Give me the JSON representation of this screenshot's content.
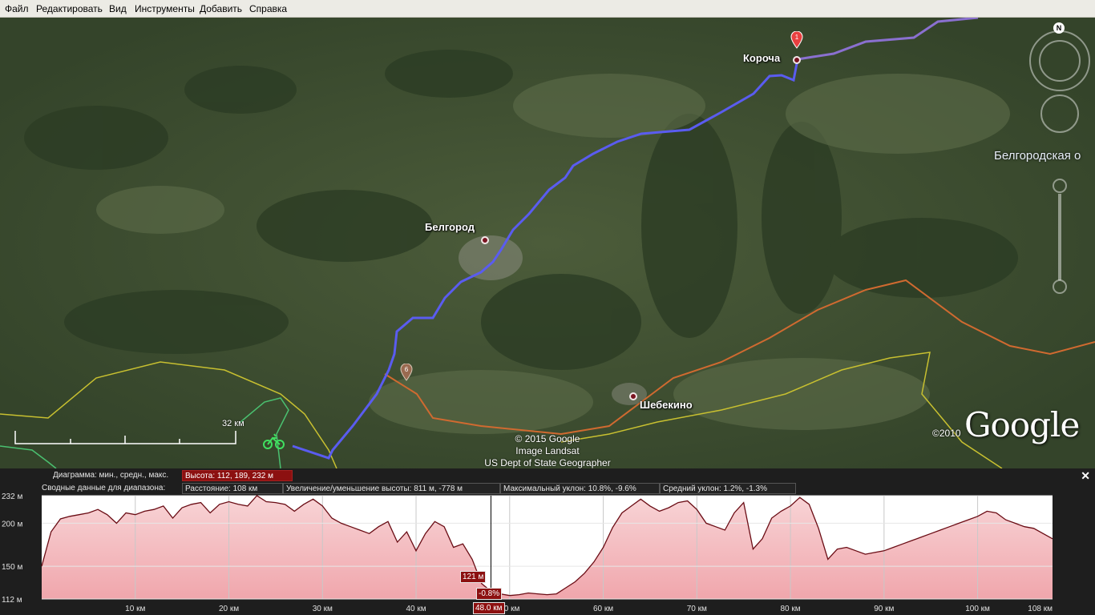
{
  "menu": [
    "Файл",
    "Редактировать",
    "Вид",
    "Инструменты",
    "Добавить",
    "Справка"
  ],
  "map": {
    "places": [
      {
        "name": "Короча"
      },
      {
        "name": "Белгород"
      },
      {
        "name": "Шебекино"
      }
    ],
    "region_label": "Белгородская о",
    "marker_a": "1",
    "marker_b": "6",
    "scale_label": "32 км",
    "attribution": [
      "© 2015 Google",
      "Image Landsat",
      "US Dept of State Geographer"
    ],
    "google_logo": "Google",
    "copyright_year": "©2010",
    "compass_letter": "N",
    "colors": {
      "track": "#5a5cf0",
      "border_orange": "#d06a30",
      "border_yellow": "#c8c030",
      "border_green": "#4ac070"
    },
    "icons": [
      "cyclist-icon",
      "compass-icon",
      "look-joystick-icon",
      "zoom-slider-icon",
      "placemark-icon"
    ]
  },
  "elevation": {
    "diagram_label": "Диаграмма: мин., средн., макс.",
    "height_value": "Высота: 112, 189, 232 м",
    "range_label": "Сводные данные для диапазона:",
    "distance": "Расстояние: 108 км",
    "gain_loss": "Увеличение/уменьшение высоты: 811 м, -778 м",
    "max_slope": "Максимальный уклон: 10.8%, -9.6%",
    "avg_slope": "Средний уклон: 1.2%, -1.3%",
    "close_label": "✕",
    "cursor_elevation": "121 м",
    "cursor_slope": "-0.8%",
    "cursor_distance": "48.0 км",
    "colors": {
      "fill": "#f4b8bc",
      "line": "#6a0c14",
      "accent": "#8c1010"
    }
  },
  "chart_data": {
    "type": "area",
    "xlabel": "",
    "ylabel": "",
    "xlim": [
      0,
      108
    ],
    "ylim": [
      112,
      232
    ],
    "x_tick_labels": [
      "10 км",
      "20 км",
      "30 км",
      "40 км",
      "50 км",
      "60 км",
      "70 км",
      "80 км",
      "90 км",
      "100 км",
      "108 км"
    ],
    "x_ticks": [
      10,
      20,
      30,
      40,
      50,
      60,
      70,
      80,
      90,
      100,
      108
    ],
    "y_tick_labels": [
      "232 м",
      "200 м",
      "150 м",
      "112 м"
    ],
    "y_ticks": [
      232,
      200,
      150,
      112
    ],
    "cursor_x": 48.0,
    "series": [
      {
        "x": [
          0,
          1,
          2,
          3,
          4,
          5,
          6,
          7,
          8,
          9,
          10,
          11,
          12,
          13,
          14,
          15,
          16,
          17,
          18,
          19,
          20,
          21,
          22,
          23,
          24,
          25,
          26,
          27,
          28,
          29,
          30,
          31,
          32,
          33,
          34,
          35,
          36,
          37,
          38,
          39,
          40,
          41,
          42,
          43,
          44,
          45,
          46,
          47,
          48,
          49,
          50,
          51,
          52,
          53,
          54,
          55,
          56,
          57,
          58,
          59,
          60,
          61,
          62,
          63,
          64,
          65,
          66,
          67,
          68,
          69,
          70,
          71,
          72,
          73,
          74,
          75,
          76,
          77,
          78,
          79,
          80,
          81,
          82,
          83,
          84,
          85,
          86,
          87,
          88,
          89,
          90,
          91,
          92,
          93,
          94,
          95,
          96,
          97,
          98,
          99,
          100,
          101,
          102,
          103,
          104,
          105,
          106,
          107,
          108
        ],
        "values": [
          150,
          190,
          205,
          208,
          210,
          212,
          216,
          210,
          200,
          212,
          210,
          214,
          216,
          220,
          206,
          218,
          222,
          224,
          212,
          222,
          225,
          222,
          220,
          232,
          225,
          224,
          222,
          214,
          222,
          228,
          220,
          206,
          200,
          196,
          192,
          188,
          196,
          202,
          178,
          190,
          168,
          188,
          202,
          196,
          172,
          176,
          158,
          130,
          121,
          118,
          116,
          117,
          119,
          118,
          117,
          118,
          125,
          132,
          142,
          155,
          172,
          195,
          212,
          220,
          228,
          220,
          214,
          218,
          224,
          226,
          216,
          200,
          196,
          192,
          212,
          224,
          170,
          182,
          206,
          214,
          220,
          230,
          222,
          194,
          158,
          170,
          172,
          168,
          164,
          166,
          168,
          172,
          176,
          180,
          184,
          188,
          192,
          196,
          200,
          204,
          208,
          214,
          212,
          204,
          200,
          196,
          194,
          188,
          182
        ]
      }
    ]
  }
}
